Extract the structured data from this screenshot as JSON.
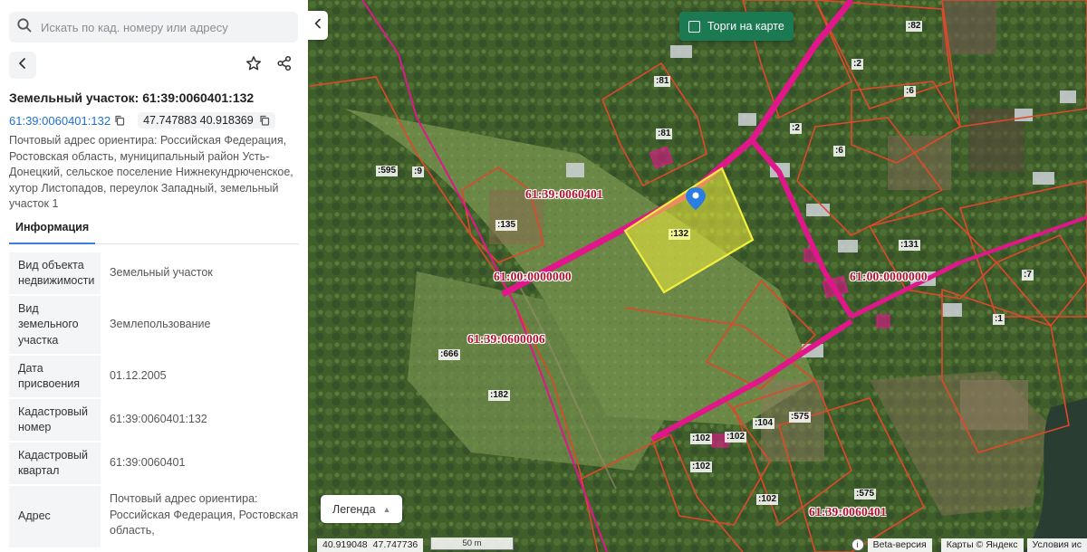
{
  "search": {
    "placeholder": "Искать по кад. номеру или адресу",
    "icon": "search-icon"
  },
  "toolbar": {
    "back_icon": "chevron-left-icon",
    "star_icon": "star-icon",
    "share_icon": "share-icon"
  },
  "parcel": {
    "title": "Земельный участок: 61:39:0060401:132",
    "cadastral_link": "61:39:0060401:132",
    "coordinates": "47.747883 40.918369",
    "address": "Почтовый адрес ориентира: Российская Федерация, Ростовская область, муниципальный район Усть-Донецкий, сельское поселение Нижнекундрюченское, хутор Листопадов, переулок Западный, земельный участок 1"
  },
  "tabs": [
    {
      "label": "Информация",
      "active": true
    }
  ],
  "info_rows": [
    {
      "key": "Вид объекта недвижимости",
      "value": "Земельный участок"
    },
    {
      "key": "Вид земельного участка",
      "value": "Землепользование"
    },
    {
      "key": "Дата присвоения",
      "value": "01.12.2005"
    },
    {
      "key": "Кадастровый номер",
      "value": "61:39:0060401:132"
    },
    {
      "key": "Кадастровый квартал",
      "value": "61:39:0060401"
    },
    {
      "key": "Адрес",
      "value": "Почтовый адрес ориентира: Российская Федерация, Ростовская область,"
    }
  ],
  "map": {
    "auction_toggle": "Торги на карте",
    "legend_button": "Легенда",
    "cursor_lon": "40.919048",
    "cursor_lat": "47.747736",
    "scale_label": "50 m",
    "beta_label": "Beta-версия",
    "attribution": "Карты © Яндекс",
    "terms": "Условия ис",
    "info_icon": "info-icon",
    "quarter_labels": [
      "61:39:0060401",
      "61:00:0000000",
      "61:39:0600006",
      "61:00:0000000",
      "61:39:0060401"
    ],
    "parcel_labels": [
      ":81",
      ":81",
      ":82",
      ":2",
      ":6",
      ":2",
      ":6",
      ":595",
      ":9",
      ":135",
      ":132",
      ":131",
      ":7",
      ":1",
      ":666",
      ":182",
      ":104",
      ":575",
      ":102",
      ":102",
      ":102",
      ":102",
      ":575"
    ],
    "colors": {
      "quarter_boundary": "#e0168a",
      "parcel_boundary": "#e0482a",
      "selected_fill": "#f3ef3c",
      "accent": "#1f6fd1",
      "auction_bg": "#1b7a52"
    }
  }
}
